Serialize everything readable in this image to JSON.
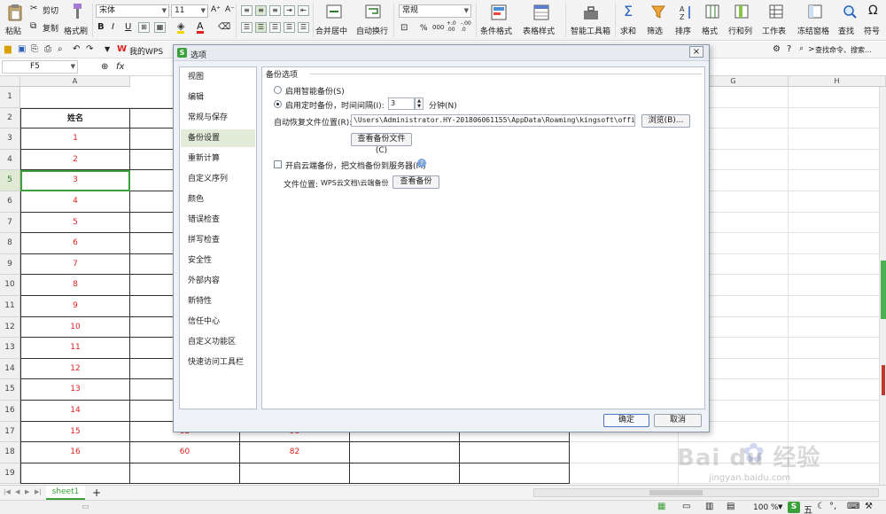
{
  "toolbar": {
    "paste": "粘贴",
    "cut": "剪切",
    "copy": "复制",
    "format_painter": "格式刷",
    "font_name": "宋体",
    "font_size": "11",
    "merge_center": "合并居中",
    "wrap_text": "自动换行",
    "number_format": "常规",
    "percent": "%",
    "comma": "000",
    "decimal_add": "+.0 .00",
    "decimal_remove": "-.00 .0",
    "conditional_format": "条件格式",
    "table_style": "表格样式",
    "smart_toolbox": "智能工具箱",
    "sum": "求和",
    "filter": "筛选",
    "sort": "排序",
    "format": "格式",
    "rows_cols": "行和列",
    "worksheet": "工作表",
    "freeze": "冻结窗格",
    "find": "查找",
    "symbol": "符号",
    "bold": "B",
    "italic": "I",
    "underline": "U",
    "font_color_a": "A"
  },
  "quickbar": {
    "wps_tab": "我的WPS",
    "search_hint": "查找命令、搜索..."
  },
  "formula": {
    "cell_ref": "F5",
    "fx": "fx"
  },
  "sheet": {
    "columns": [
      "A",
      "G",
      "H"
    ],
    "rows": [
      "1",
      "2",
      "3",
      "4",
      "5",
      "6",
      "7",
      "8",
      "9",
      "10",
      "11",
      "12",
      "13",
      "14",
      "15",
      "16",
      "17",
      "18",
      "19"
    ],
    "header_name": "姓名",
    "names": [
      "1",
      "2",
      "3",
      "4",
      "5",
      "6",
      "7",
      "8",
      "9",
      "10",
      "11",
      "12",
      "13",
      "14",
      "15",
      "16"
    ],
    "row17_b": "82",
    "row17_c": "98",
    "row18_b": "60",
    "row18_c": "82"
  },
  "dialog": {
    "title": "选项",
    "close": "×",
    "nav": [
      "视图",
      "编辑",
      "常规与保存",
      "备份设置",
      "重新计算",
      "自定义序列",
      "颜色",
      "错误检查",
      "拼写检查",
      "安全性",
      "外部内容",
      "新特性",
      "信任中心",
      "自定义功能区",
      "快速访问工具栏"
    ],
    "active_nav": "备份设置",
    "section_title": "备份选项",
    "opt_smart": "启用智能备份(S)",
    "opt_timed": "启用定时备份，时间间隔(I):",
    "interval_value": "3",
    "minutes": "分钟(N)",
    "recovery_label": "自动恢复文件位置(R):",
    "recovery_path": "\\Users\\Administrator.HY-201806061155\\AppData\\Roaming\\kingsoft\\office6\\backup",
    "browse": "浏览(B)...",
    "view_backup_files": "查看备份文件(C)",
    "cloud_backup": "开启云端备份，把文档备份到服务器(M)",
    "file_location_label": "文件位置:",
    "file_location_value": "WPS云文档\\云端备份",
    "view_backup": "查看备份",
    "ok": "确定",
    "cancel": "取消"
  },
  "tabs": {
    "sheet1": "sheet1",
    "add": "+"
  },
  "status": {
    "zoom": "100 %",
    "ime": "五"
  },
  "watermark": {
    "text": "Bai du 经验",
    "url": "jingyan.baidu.com"
  }
}
